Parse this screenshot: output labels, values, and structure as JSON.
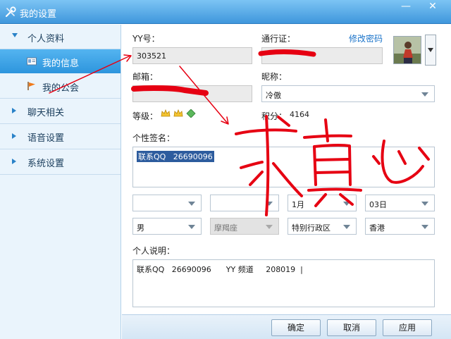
{
  "window": {
    "title": "我的设置",
    "min_glyph": "—",
    "close_glyph": "✕"
  },
  "sidebar": {
    "groups": [
      {
        "label": "个人资料",
        "expanded": true
      },
      {
        "label": "聊天相关",
        "expanded": false
      },
      {
        "label": "语音设置",
        "expanded": false
      },
      {
        "label": "系统设置",
        "expanded": false
      }
    ],
    "sub_items": [
      {
        "label": "我的信息",
        "icon": "id-card-icon",
        "active": true
      },
      {
        "label": "我的公会",
        "icon": "flag-icon",
        "active": false
      }
    ]
  },
  "profile": {
    "yy_label": "YY号：",
    "yy_value": "303521",
    "pass_label": "通行证：",
    "change_password": "修改密码",
    "email_label": "邮箱：",
    "nick_label": "昵称：",
    "nick_value": "冷傲",
    "level_label": "等级：",
    "points_label": "积分：",
    "points_value": "4164",
    "signature_label": "个性签名：",
    "signature_value": "联系QQ   26690096",
    "birth_month": "1月",
    "birth_day": "03日",
    "gender": "男",
    "zodiac": "摩羯座",
    "region": "特别行政区",
    "city": "香港",
    "desc_label": "个人说明：",
    "desc_value": "联系QQ   26690096      YY 频道     208019  |"
  },
  "buttons": {
    "ok": "确定",
    "cancel": "取消",
    "apply": "应用"
  },
  "colors": {
    "titlebar": "#3f97dc",
    "active_item": "#2d95dd",
    "link": "#1a73c9",
    "scribble": "#e60012"
  }
}
